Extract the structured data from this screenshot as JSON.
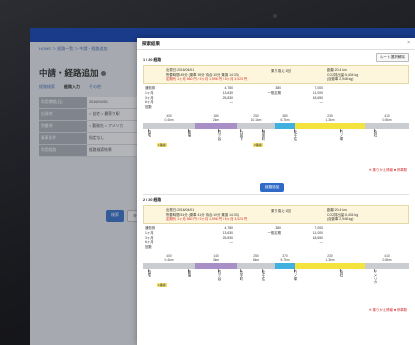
{
  "breadcrumb": "HOME ＞ 経路一覧 ＞ 中請・経路追加",
  "page_title": "中請・経路追加",
  "left_tabs": [
    "経路検索",
    "経路入力",
    "その他"
  ],
  "left_table": [
    {
      "key": "利用期間(日)",
      "value": "2016/04/01"
    },
    {
      "key": "出発地",
      "value": "○ 自宅 ○ 最寄り駅"
    },
    {
      "key": "到着地",
      "value": "○ 勤務先 ○ アメリカ"
    },
    {
      "key": "乗車条件",
      "value": "指定なし"
    },
    {
      "key": "利用経路",
      "value": "経路検索結果"
    }
  ],
  "left_buttons": {
    "search": "検索",
    "cancel": "キャンセル"
  },
  "modal": {
    "title": "探索結果",
    "close": "×",
    "print_label": "ルート選択解除",
    "register_label": "経路追加",
    "routes": [
      {
        "title": "1 / 20 経路",
        "sum_lines": [
          "出発日:2016/04/01",
          "所要時間:49分 (乗車 39分 待合:10分 乗換 14:33)",
          "定期代 1ヶ月 560 円 / 3ヶ月 1,596 円 / 6ヶ月 3,023 円"
        ],
        "sum_transfer": "乗り換え:1回",
        "sum_right": [
          "距離:20.4 km",
          "CO2排出量:5,404 kg",
          "(自動車 2,948 kg)"
        ],
        "fare_labels": [
          "通勤券",
          "1ヶ月",
          "3ヶ月",
          "6ヶ月",
          "回数"
        ],
        "fare_cols": [
          [
            "",
            "4,780",
            "13,630",
            "25,830",
            "—"
          ],
          [
            "380",
            "",
            "",
            "",
            "一般定期"
          ],
          [
            "",
            "7,000",
            "11,000",
            "18,650",
            "—"
          ]
        ],
        "dist_top": [
          "400",
          "180",
          "250",
          "380",
          "230",
          "410"
        ],
        "dist_bottom": [
          "0.4km",
          "2km",
          "10.1km",
          "6.7km",
          "1.3km",
          "0.8km"
        ],
        "stations": [
          "自宅",
          "新宿",
          "四ツ谷",
          "九段下",
          "神保町",
          "北千住",
          "竹ノ塚",
          "会社"
        ],
        "platforms": [
          "1番線",
          "2番線"
        ],
        "via": [
          "徒歩",
          "JR中央線",
          "東京メトロ",
          "東武線",
          "徒歩"
        ],
        "note": "※ 乗りかえ情報 ■ 停車駅"
      },
      {
        "title": "2 / 20 経路",
        "sum_lines": [
          "出発日:2016/04/01",
          "所要時間:51分 (乗車 41分 待合:10分 乗換 14:33)",
          "定期代 1ヶ月 560 円 / 3ヶ月 1,596 円 / 6ヶ月 3,023 円"
        ],
        "sum_transfer": "乗り換え:1回",
        "sum_right": [
          "距離:20.4 km",
          "CO2排出量:5,404 kg",
          "(自動車 2,948 kg)"
        ],
        "fare_labels": [
          "通勤券",
          "1ヶ月",
          "3ヶ月",
          "6ヶ月",
          "回数"
        ],
        "fare_cols": [
          [
            "",
            "4,780",
            "13,630",
            "25,830",
            "—"
          ],
          [
            "380",
            "",
            "",
            "",
            "一般定期"
          ],
          [
            "",
            "7,000",
            "11,000",
            "18,650",
            "—"
          ]
        ],
        "dist_top": [
          "400",
          "140",
          "250",
          "370",
          "230",
          "410"
        ],
        "dist_bottom": [
          "0.4km",
          "3km",
          "8km",
          "5.7km",
          "1.3km",
          "0.8km"
        ],
        "stations": [
          "自宅",
          "新宿",
          "四ツ谷",
          "大手町",
          "北千住",
          "竹ノ塚",
          "会社",
          "アメリカ"
        ],
        "platforms": [
          "1番線"
        ],
        "via": [
          "徒歩",
          "JR中央線",
          "東京メトロ",
          "東武線",
          "徒歩"
        ],
        "note": "※ 乗りかえ情報 ■ 停車駅"
      }
    ]
  },
  "colors": {
    "bar_gray": "#c9ccd1",
    "bar_purple": "#a98fc8",
    "bar_cyan": "#3fb0df",
    "bar_yellow": "#f4e23f",
    "accent": "#2e6ac6",
    "note_red": "#d12b2b"
  }
}
